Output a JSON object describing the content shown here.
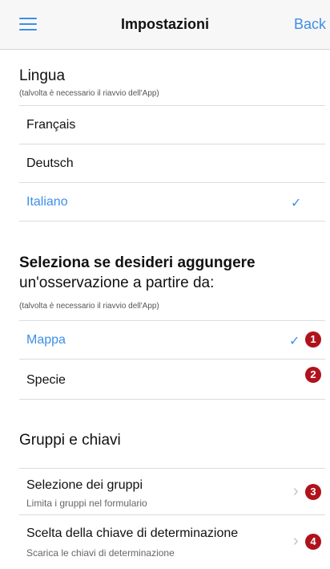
{
  "navbar": {
    "title": "Impostazioni",
    "back_label": "Back"
  },
  "language": {
    "title": "Lingua",
    "subtitle": "(talvolta è necessario il riavvio dell'App)",
    "options": [
      {
        "label": "Français",
        "selected": false
      },
      {
        "label": "Deutsch",
        "selected": false
      },
      {
        "label": "Italiano",
        "selected": true
      }
    ],
    "check_mark": "✓"
  },
  "observation": {
    "title_line1": "Seleziona se desideri aggungere",
    "title_line2": "un'osservazione a partire da:",
    "subtitle": "(talvolta è necessario il riavvio dell'App)",
    "options": [
      {
        "label": "Mappa",
        "selected": true,
        "badge": "1"
      },
      {
        "label": "Specie",
        "selected": false,
        "badge": "2"
      }
    ],
    "check_mark": "✓"
  },
  "groups": {
    "title": "Gruppi e chiavi",
    "items": [
      {
        "label": "Selezione dei gruppi",
        "sublabel": "Limita i gruppi nel formulario",
        "badge": "3"
      },
      {
        "label": "Scelta della chiave di determinazione",
        "sublabel": "Scarica le chiavi di determinazione",
        "badge": "4"
      }
    ],
    "chevron": "›"
  },
  "colors": {
    "accent": "#3e8ee8",
    "badge": "#b0121b"
  },
  "icons": {
    "menu": "hamburger-menu-icon",
    "check": "checkmark-icon",
    "chevron": "chevron-right-icon"
  }
}
